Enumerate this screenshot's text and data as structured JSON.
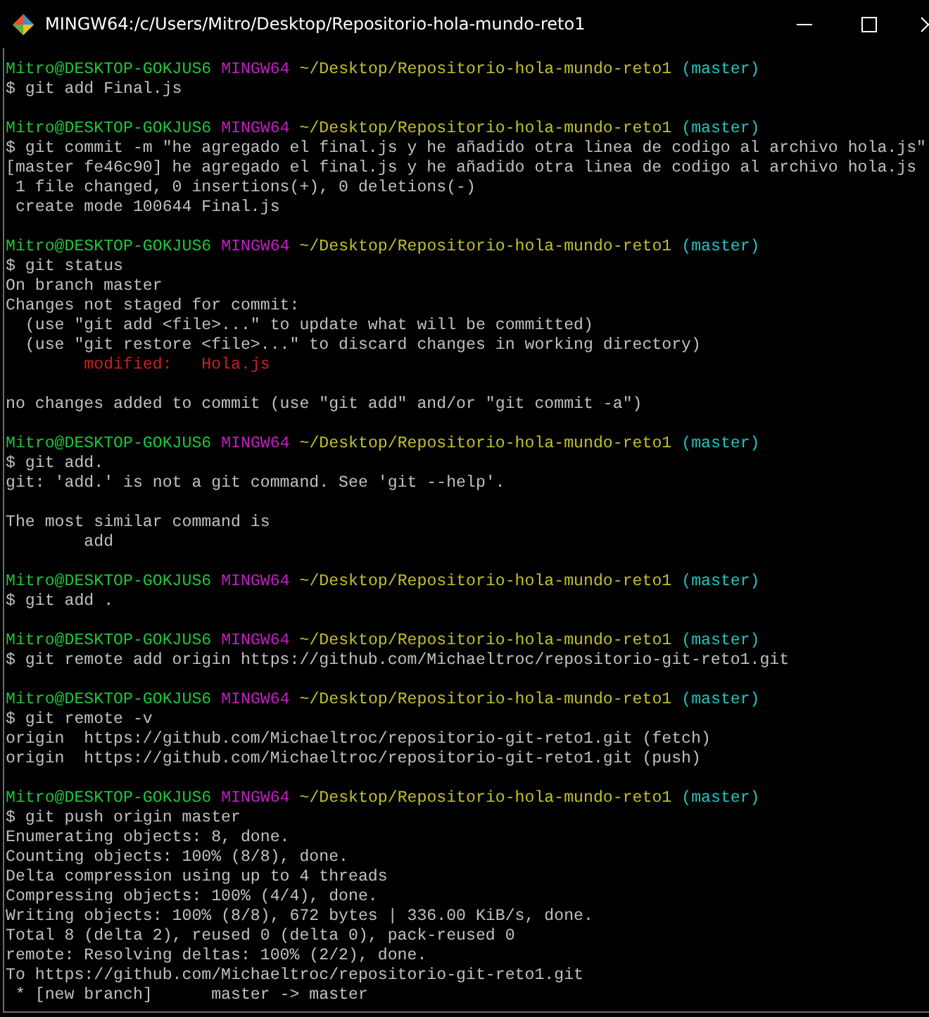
{
  "window": {
    "title": "MINGW64:/c/Users/Mitro/Desktop/Repositorio-hola-mundo-reto1"
  },
  "lines": [
    {
      "kind": "prompt",
      "user": "Mitro@DESKTOP-GOKJUS6",
      "shell": "MINGW64",
      "path": "~/Desktop/Repositorio-hola-mundo-reto1",
      "branch": "(master)"
    },
    {
      "kind": "command",
      "text": "$ git add Final.js"
    },
    {
      "kind": "blank"
    },
    {
      "kind": "prompt",
      "user": "Mitro@DESKTOP-GOKJUS6",
      "shell": "MINGW64",
      "path": "~/Desktop/Repositorio-hola-mundo-reto1",
      "branch": "(master)"
    },
    {
      "kind": "command",
      "text": "$ git commit -m \"he agregado el final.js y he añadido otra linea de codigo al archivo hola.js\""
    },
    {
      "kind": "output",
      "text": "[master fe46c90] he agregado el final.js y he añadido otra linea de codigo al archivo hola.js"
    },
    {
      "kind": "output",
      "text": " 1 file changed, 0 insertions(+), 0 deletions(-)"
    },
    {
      "kind": "output",
      "text": " create mode 100644 Final.js"
    },
    {
      "kind": "blank"
    },
    {
      "kind": "prompt",
      "user": "Mitro@DESKTOP-GOKJUS6",
      "shell": "MINGW64",
      "path": "~/Desktop/Repositorio-hola-mundo-reto1",
      "branch": "(master)"
    },
    {
      "kind": "command",
      "text": "$ git status"
    },
    {
      "kind": "output",
      "text": "On branch master"
    },
    {
      "kind": "output",
      "text": "Changes not staged for commit:"
    },
    {
      "kind": "output",
      "text": "  (use \"git add <file>...\" to update what will be committed)"
    },
    {
      "kind": "output",
      "text": "  (use \"git restore <file>...\" to discard changes in working directory)"
    },
    {
      "kind": "modified",
      "text": "        modified:   Hola.js"
    },
    {
      "kind": "blank"
    },
    {
      "kind": "output",
      "text": "no changes added to commit (use \"git add\" and/or \"git commit -a\")"
    },
    {
      "kind": "blank"
    },
    {
      "kind": "prompt",
      "user": "Mitro@DESKTOP-GOKJUS6",
      "shell": "MINGW64",
      "path": "~/Desktop/Repositorio-hola-mundo-reto1",
      "branch": "(master)"
    },
    {
      "kind": "command",
      "text": "$ git add."
    },
    {
      "kind": "output",
      "text": "git: 'add.' is not a git command. See 'git --help'."
    },
    {
      "kind": "blank"
    },
    {
      "kind": "output",
      "text": "The most similar command is"
    },
    {
      "kind": "output",
      "text": "        add"
    },
    {
      "kind": "blank"
    },
    {
      "kind": "prompt",
      "user": "Mitro@DESKTOP-GOKJUS6",
      "shell": "MINGW64",
      "path": "~/Desktop/Repositorio-hola-mundo-reto1",
      "branch": "(master)"
    },
    {
      "kind": "command",
      "text": "$ git add ."
    },
    {
      "kind": "blank"
    },
    {
      "kind": "prompt",
      "user": "Mitro@DESKTOP-GOKJUS6",
      "shell": "MINGW64",
      "path": "~/Desktop/Repositorio-hola-mundo-reto1",
      "branch": "(master)"
    },
    {
      "kind": "command",
      "text": "$ git remote add origin https://github.com/Michaeltroc/repositorio-git-reto1.git"
    },
    {
      "kind": "blank"
    },
    {
      "kind": "prompt",
      "user": "Mitro@DESKTOP-GOKJUS6",
      "shell": "MINGW64",
      "path": "~/Desktop/Repositorio-hola-mundo-reto1",
      "branch": "(master)"
    },
    {
      "kind": "command",
      "text": "$ git remote -v"
    },
    {
      "kind": "output",
      "text": "origin  https://github.com/Michaeltroc/repositorio-git-reto1.git (fetch)"
    },
    {
      "kind": "output",
      "text": "origin  https://github.com/Michaeltroc/repositorio-git-reto1.git (push)"
    },
    {
      "kind": "blank"
    },
    {
      "kind": "prompt",
      "user": "Mitro@DESKTOP-GOKJUS6",
      "shell": "MINGW64",
      "path": "~/Desktop/Repositorio-hola-mundo-reto1",
      "branch": "(master)"
    },
    {
      "kind": "command",
      "text": "$ git push origin master"
    },
    {
      "kind": "output",
      "text": "Enumerating objects: 8, done."
    },
    {
      "kind": "output",
      "text": "Counting objects: 100% (8/8), done."
    },
    {
      "kind": "output",
      "text": "Delta compression using up to 4 threads"
    },
    {
      "kind": "output",
      "text": "Compressing objects: 100% (4/4), done."
    },
    {
      "kind": "output",
      "text": "Writing objects: 100% (8/8), 672 bytes | 336.00 KiB/s, done."
    },
    {
      "kind": "output",
      "text": "Total 8 (delta 2), reused 0 (delta 0), pack-reused 0"
    },
    {
      "kind": "output",
      "text": "remote: Resolving deltas: 100% (2/2), done."
    },
    {
      "kind": "output",
      "text": "To https://github.com/Michaeltroc/repositorio-git-reto1.git"
    },
    {
      "kind": "output",
      "text": " * [new branch]      master -> master"
    }
  ]
}
